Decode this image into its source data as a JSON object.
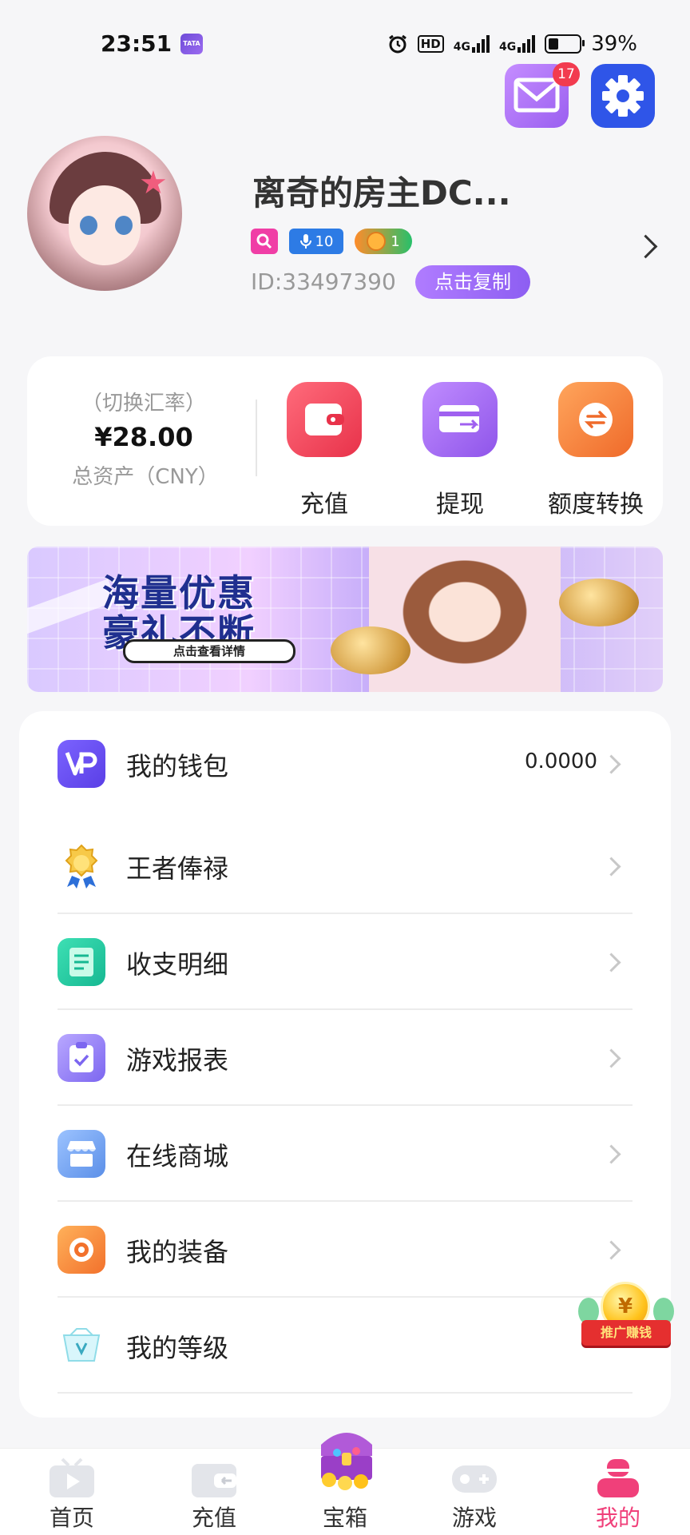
{
  "status_bar": {
    "time": "23:51",
    "app_badge": "TATA",
    "hd": "HD",
    "network1": "4G",
    "network2": "4G",
    "battery": "39%"
  },
  "header": {
    "mail_badge_count": "17"
  },
  "profile": {
    "username": "离奇的房主DC...",
    "mic_level": "10",
    "coin_level": "1",
    "user_id": "ID:33497390",
    "copy_label": "点击复制"
  },
  "assets": {
    "rate_label": "（切换汇率）",
    "amount": "¥28.00",
    "total_label": "总资产（CNY）",
    "actions": [
      {
        "label": "充值",
        "icon": "wallet-icon",
        "color": "#f0455d"
      },
      {
        "label": "提现",
        "icon": "card-transfer-icon",
        "color": "#a060f0"
      },
      {
        "label": "额度转换",
        "icon": "exchange-icon",
        "color": "#f57a30"
      }
    ]
  },
  "banner": {
    "line1": "海量优惠",
    "line2": "豪礼不断",
    "cta": "点击查看详情"
  },
  "menu": [
    {
      "label": "我的钱包",
      "value": "0.0000",
      "icon": "vp-wallet-icon"
    },
    {
      "label": "王者俸禄",
      "value": "",
      "icon": "king-medal-icon"
    },
    {
      "label": "收支明细",
      "value": "",
      "icon": "ledger-icon"
    },
    {
      "label": "游戏报表",
      "value": "",
      "icon": "clipboard-check-icon"
    },
    {
      "label": "在线商城",
      "value": "",
      "icon": "store-icon"
    },
    {
      "label": "我的装备",
      "value": "",
      "icon": "equipment-icon"
    },
    {
      "label": "我的等级",
      "value": "",
      "icon": "level-icon"
    }
  ],
  "promo": {
    "coin": "¥",
    "label": "推广赚钱"
  },
  "bottom_nav": [
    {
      "label": "首页",
      "icon": "play-tv-icon",
      "active": false
    },
    {
      "label": "充值",
      "icon": "wallet-card-icon",
      "active": false
    },
    {
      "label": "宝箱",
      "icon": "treasure-chest-icon",
      "active": false
    },
    {
      "label": "游戏",
      "icon": "gamepad-icon",
      "active": false
    },
    {
      "label": "我的",
      "icon": "user-icon",
      "active": true
    }
  ],
  "colors": {
    "accent_purple": "#9a5ff0",
    "accent_blue": "#2f55e8",
    "active_nav": "#f0407a"
  }
}
